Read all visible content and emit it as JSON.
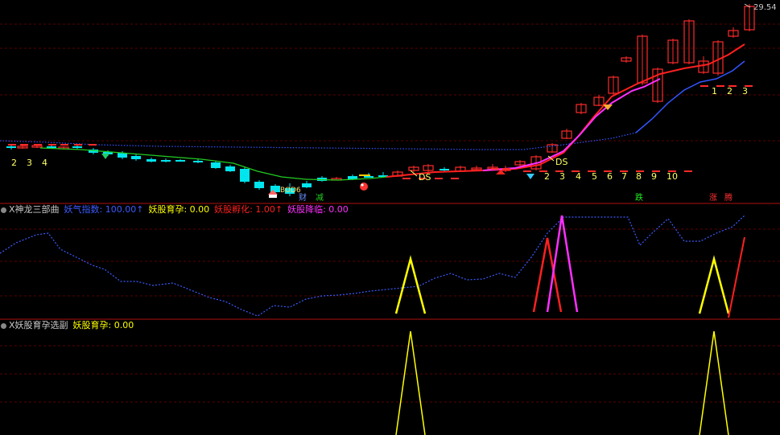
{
  "price_label": "29.54",
  "panel1_title": "X神龙三部曲",
  "panel1_items": [
    {
      "label": "妖气指数:",
      "value": "100.00",
      "arrow": "↑",
      "color": "#3b5bff"
    },
    {
      "label": "妖股育孕:",
      "value": "0.00",
      "arrow": "",
      "color": "#ffff00"
    },
    {
      "label": "妖股孵化:",
      "value": "1.00",
      "arrow": "↑",
      "color": "#ff2020"
    },
    {
      "label": "妖股降临:",
      "value": "0.00",
      "arrow": "",
      "color": "#ff30ff"
    }
  ],
  "panel2_title": "X妖股育孕选副",
  "panel2_items": [
    {
      "label": "妖股育孕:",
      "value": "0.00",
      "color": "#ffff00"
    }
  ],
  "left_counts": [
    "2",
    "3",
    "4"
  ],
  "mid_counts": [
    "2",
    "3",
    "4",
    "5",
    "6",
    "7",
    "8",
    "9",
    "10"
  ],
  "right_counts": [
    "1",
    "2",
    "3"
  ],
  "ds_labels": [
    "DS",
    "DS"
  ],
  "tags": {
    "cai": "财",
    "jian": "减",
    "die": "跌",
    "zhang": "涨",
    "teng": "腾",
    "low_note": "BOD6"
  },
  "colors": {
    "up": "#ff2a2a",
    "down": "#00e5ee",
    "ma_green": "#22cc22",
    "ma_blue": "#3355ff",
    "ma_magenta": "#ff30ff",
    "ma_red": "#ff2020"
  }
}
